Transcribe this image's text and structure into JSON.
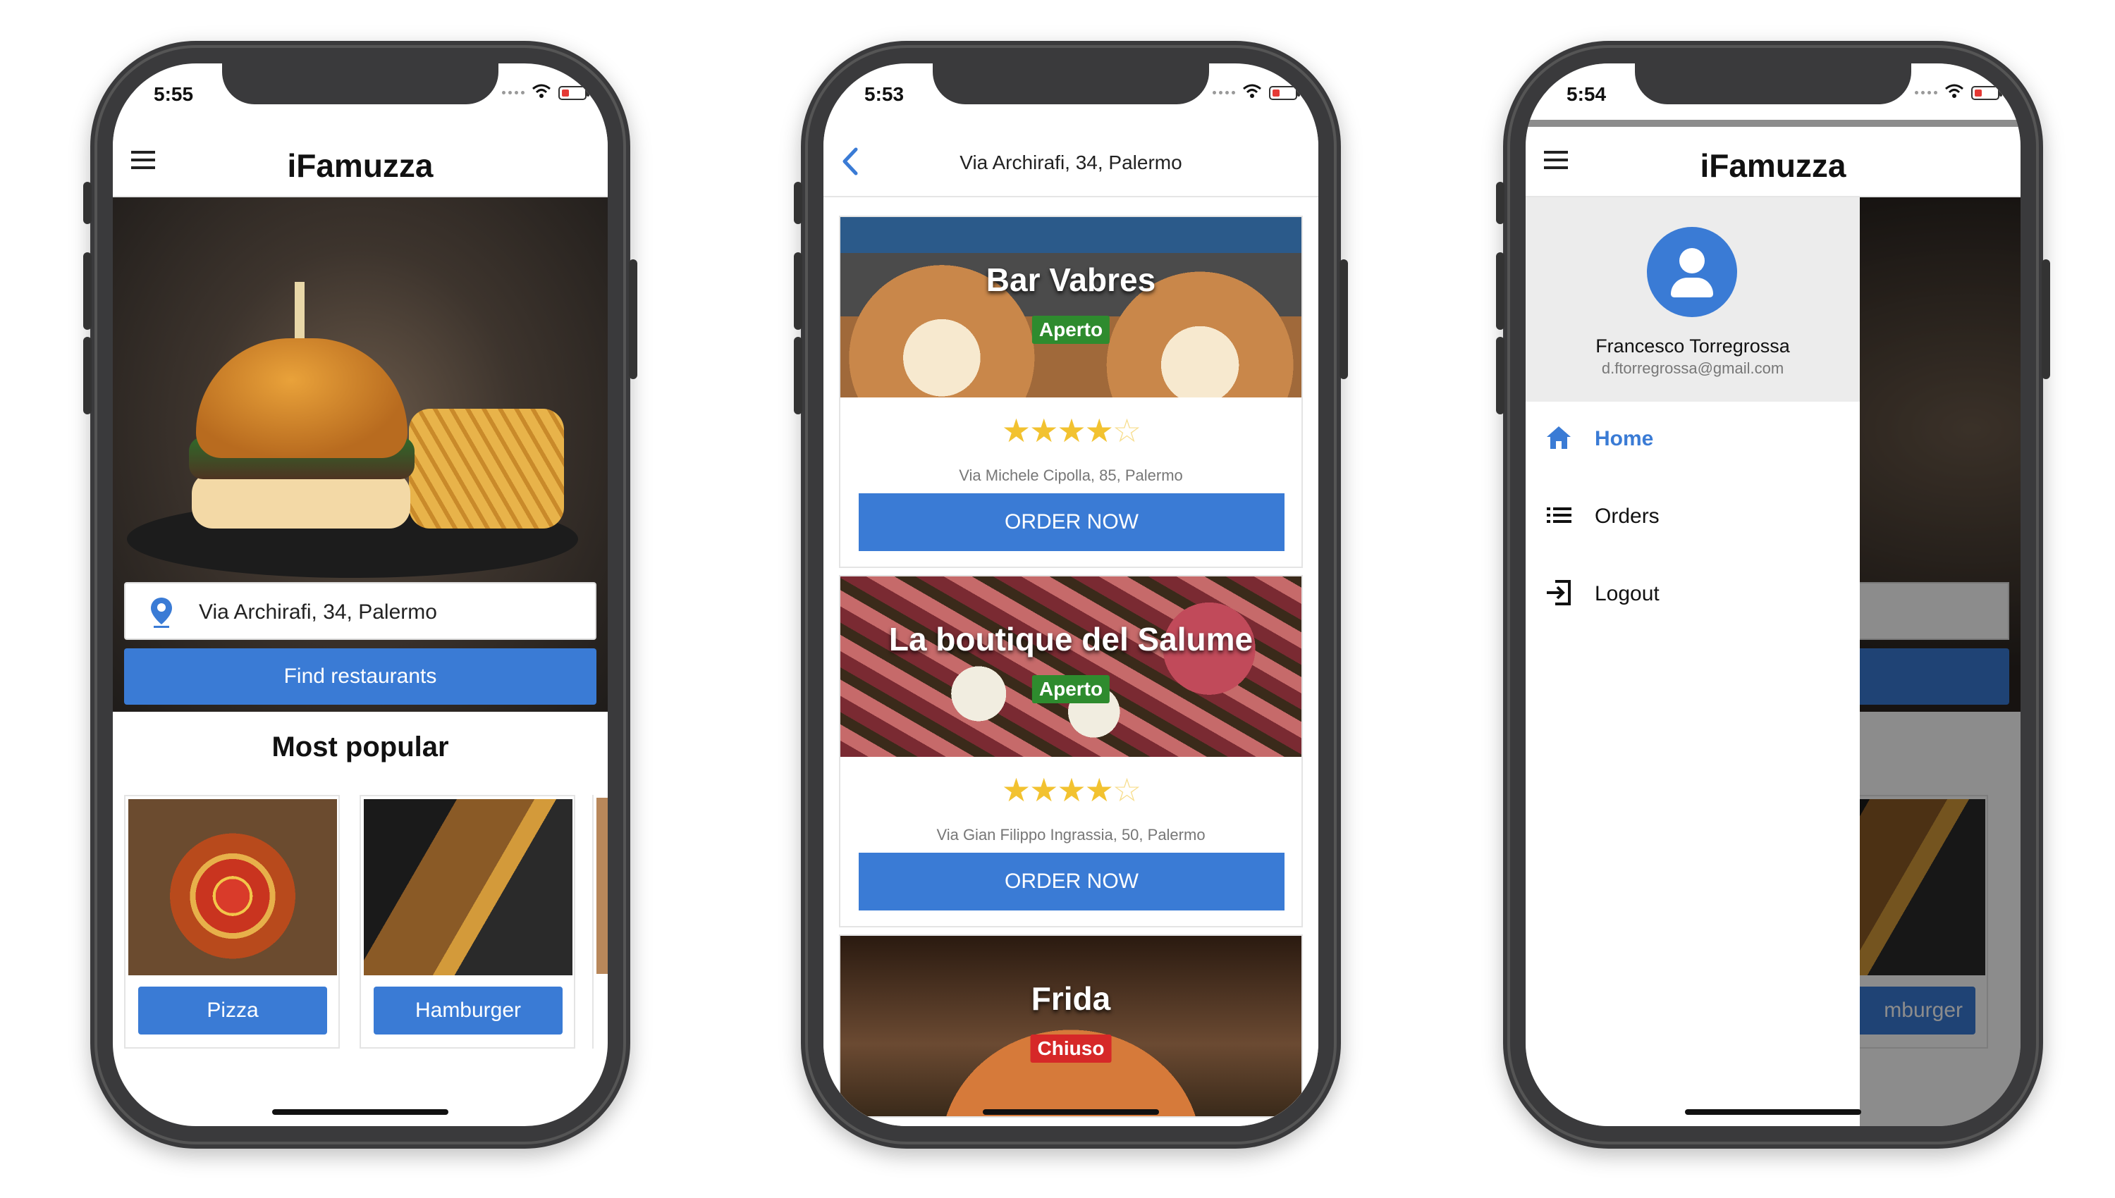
{
  "colors": {
    "primary": "#3a7bd5",
    "open": "#2e8b2e",
    "closed": "#d62828",
    "star": "#f2c230"
  },
  "screen_home": {
    "status_time": "5:55",
    "title": "iFamuzza",
    "address": "Via Archirafi, 34, Palermo",
    "find_button": "Find restaurants",
    "section_title": "Most popular",
    "popular": [
      {
        "label": "Pizza",
        "icon": "pizza-image"
      },
      {
        "label": "Hamburger",
        "icon": "burger-image"
      }
    ]
  },
  "screen_list": {
    "status_time": "5:53",
    "header": "Via Archirafi, 34, Palermo",
    "restaurants": [
      {
        "name": "Bar Vabres",
        "status": "Aperto",
        "rating": 4,
        "address": "Via Michele Cipolla, 85, Palermo",
        "order": "ORDER NOW"
      },
      {
        "name": "La boutique del Salume",
        "status": "Aperto",
        "rating": 4,
        "address": "Via Gian Filippo Ingrassia, 50, Palermo",
        "order": "ORDER NOW"
      },
      {
        "name": "Frida",
        "status": "Chiuso"
      }
    ]
  },
  "screen_drawer": {
    "status_time": "5:54",
    "title": "iFamuzza",
    "user_name": "Francesco Torregrossa",
    "user_email": "d.ftorregrossa@gmail.com",
    "menu": [
      {
        "label": "Home",
        "icon": "home-icon",
        "active": true
      },
      {
        "label": "Orders",
        "icon": "list-icon",
        "active": false
      },
      {
        "label": "Logout",
        "icon": "logout-icon",
        "active": false
      }
    ],
    "bg_button": "mburger"
  }
}
